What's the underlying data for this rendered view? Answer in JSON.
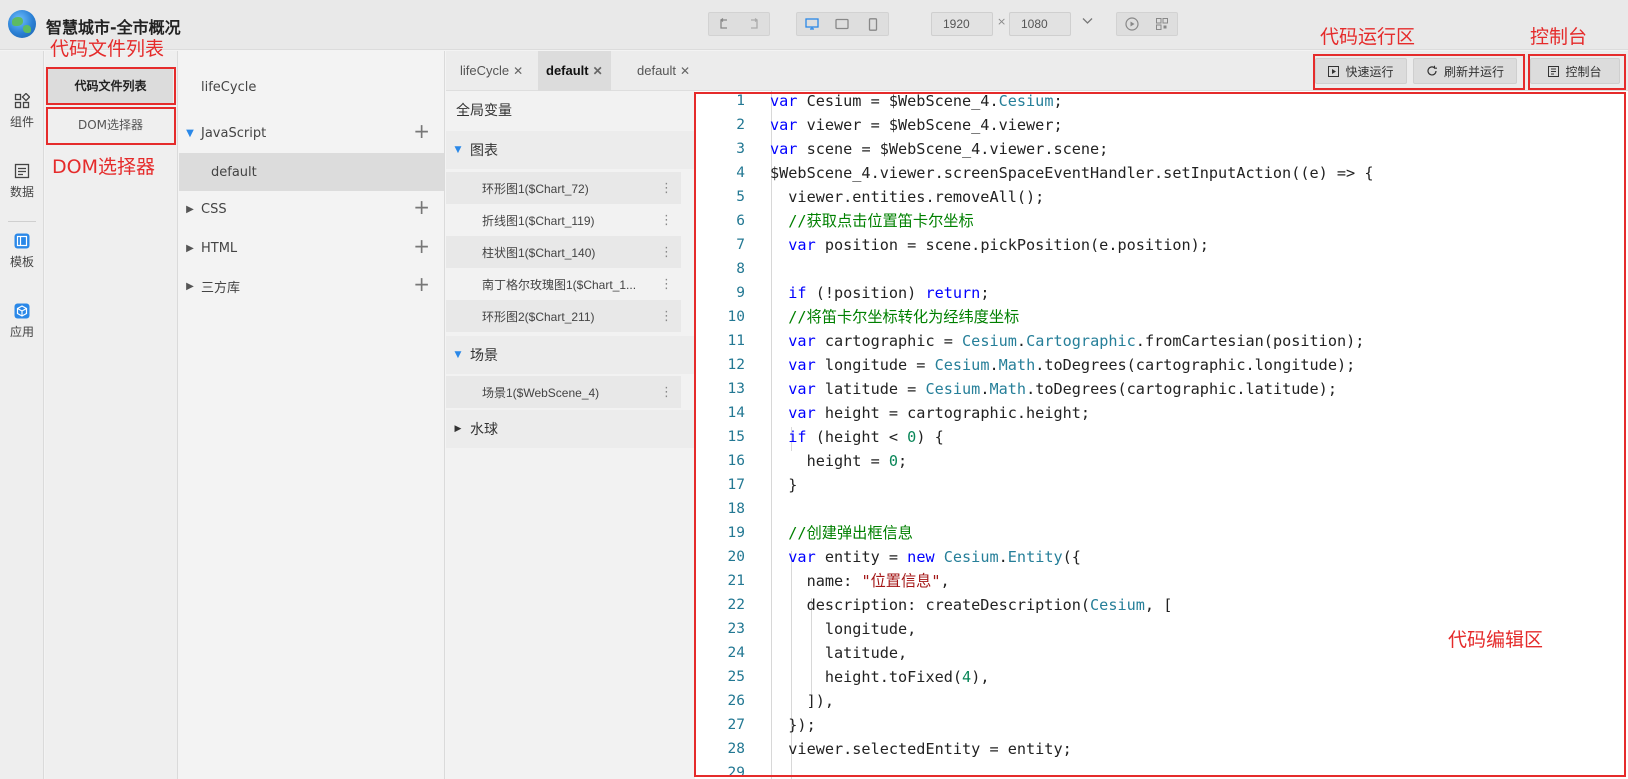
{
  "app": {
    "title": "智慧城市-全市概况"
  },
  "toolbar": {
    "width_value": "1920",
    "height_value": "1080",
    "times": "×"
  },
  "rail": [
    {
      "label": "组件",
      "icon": "components-icon"
    },
    {
      "label": "数据",
      "icon": "data-icon"
    },
    {
      "label": "模板",
      "icon": "template-icon"
    },
    {
      "label": "应用",
      "icon": "app-icon"
    }
  ],
  "panel2": {
    "file_list": "代码文件列表",
    "dom_selector": "DOM选择器"
  },
  "annotations": {
    "file_list": "代码文件列表",
    "dom_selector": "DOM选择器",
    "run_area": "代码运行区",
    "console": "控制台",
    "edit_area": "代码编辑区"
  },
  "tree": {
    "lifecycle": "lifeCycle",
    "javascript": "JavaScript",
    "default": "default",
    "css": "CSS",
    "html": "HTML",
    "third_party": "三方库",
    "plus": "+"
  },
  "tabs": [
    {
      "label": "lifeCycle",
      "active": false
    },
    {
      "label": "default",
      "active": true
    },
    {
      "label": "default",
      "active": false
    }
  ],
  "variables": {
    "global": "全局变量",
    "charts_group": "图表",
    "charts": [
      "环形图1($Chart_72)",
      "折线图1($Chart_119)",
      "柱状图1($Chart_140)",
      "南丁格尔玫瑰图1($Chart_1...",
      "环形图2($Chart_211)"
    ],
    "scene_group": "场景",
    "scenes": [
      "场景1($WebScene_4)"
    ],
    "water_group": "水球"
  },
  "buttons": {
    "quick_run": "快速运行",
    "refresh_run": "刷新并运行",
    "console": "控制台"
  },
  "code": {
    "line_numbers": [
      "1",
      "2",
      "3",
      "4",
      "5",
      "6",
      "7",
      "8",
      "9",
      "10",
      "11",
      "12",
      "13",
      "14",
      "15",
      "16",
      "17",
      "18",
      "19",
      "20",
      "21",
      "22",
      "23",
      "24",
      "25",
      "26",
      "27",
      "28",
      "29"
    ],
    "lines": [
      [
        [
          "kw",
          "var "
        ],
        [
          "",
          "Cesium = $WebScene_4."
        ],
        [
          "cls",
          "Cesium"
        ],
        [
          "",
          ";"
        ]
      ],
      [
        [
          "kw",
          "var "
        ],
        [
          "",
          "viewer = $WebScene_4.viewer;"
        ]
      ],
      [
        [
          "kw",
          "var "
        ],
        [
          "",
          "scene = $WebScene_4.viewer.scene;"
        ]
      ],
      [
        [
          "",
          "$WebScene_4.viewer.screenSpaceEventHandler.setInputAction((e) => {"
        ]
      ],
      [
        [
          "",
          "  viewer.entities.removeAll();"
        ]
      ],
      [
        [
          "cm",
          "  //获取点击位置笛卡尔坐标"
        ]
      ],
      [
        [
          "kw",
          "  var "
        ],
        [
          "",
          "position = scene.pickPosition(e.position);"
        ]
      ],
      [],
      [
        [
          "kw",
          "  if "
        ],
        [
          "",
          "(!position) "
        ],
        [
          "kw",
          "return"
        ],
        [
          "",
          ";"
        ]
      ],
      [
        [
          "cm",
          "  //将笛卡尔坐标转化为经纬度坐标"
        ]
      ],
      [
        [
          "kw",
          "  var "
        ],
        [
          "",
          "cartographic = "
        ],
        [
          "cls",
          "Cesium"
        ],
        [
          "",
          "."
        ],
        [
          "cls",
          "Cartographic"
        ],
        [
          "",
          ".fromCartesian(position);"
        ]
      ],
      [
        [
          "kw",
          "  var "
        ],
        [
          "",
          "longitude = "
        ],
        [
          "cls",
          "Cesium"
        ],
        [
          "",
          "."
        ],
        [
          "cls",
          "Math"
        ],
        [
          "",
          ".toDegrees(cartographic.longitude);"
        ]
      ],
      [
        [
          "kw",
          "  var "
        ],
        [
          "",
          "latitude = "
        ],
        [
          "cls",
          "Cesium"
        ],
        [
          "",
          "."
        ],
        [
          "cls",
          "Math"
        ],
        [
          "",
          ".toDegrees(cartographic.latitude);"
        ]
      ],
      [
        [
          "kw",
          "  var "
        ],
        [
          "",
          "height = cartographic.height;"
        ]
      ],
      [
        [
          "kw",
          "  if "
        ],
        [
          "",
          "(height < "
        ],
        [
          "num",
          "0"
        ],
        [
          "",
          ") {"
        ]
      ],
      [
        [
          "",
          "    height = "
        ],
        [
          "num",
          "0"
        ],
        [
          "",
          ";"
        ]
      ],
      [
        [
          "",
          "  }"
        ]
      ],
      [],
      [
        [
          "cm",
          "  //创建弹出框信息"
        ]
      ],
      [
        [
          "kw",
          "  var "
        ],
        [
          "",
          "entity = "
        ],
        [
          "kw",
          "new "
        ],
        [
          "cls",
          "Cesium"
        ],
        [
          "",
          "."
        ],
        [
          "cls",
          "Entity"
        ],
        [
          "",
          "({"
        ]
      ],
      [
        [
          "",
          "    name: "
        ],
        [
          "str",
          "\"位置信息\""
        ],
        [
          "",
          ","
        ]
      ],
      [
        [
          "",
          "    description: createDescription("
        ],
        [
          "cls",
          "Cesium"
        ],
        [
          "",
          ", ["
        ]
      ],
      [
        [
          "",
          "      longitude,"
        ]
      ],
      [
        [
          "",
          "      latitude,"
        ]
      ],
      [
        [
          "",
          "      height.toFixed("
        ],
        [
          "num",
          "4"
        ],
        [
          "",
          "),"
        ]
      ],
      [
        [
          "",
          "    ]),"
        ]
      ],
      [
        [
          "",
          "  });"
        ]
      ],
      [
        [
          "",
          "  viewer.selectedEntity = entity;"
        ]
      ],
      []
    ]
  }
}
